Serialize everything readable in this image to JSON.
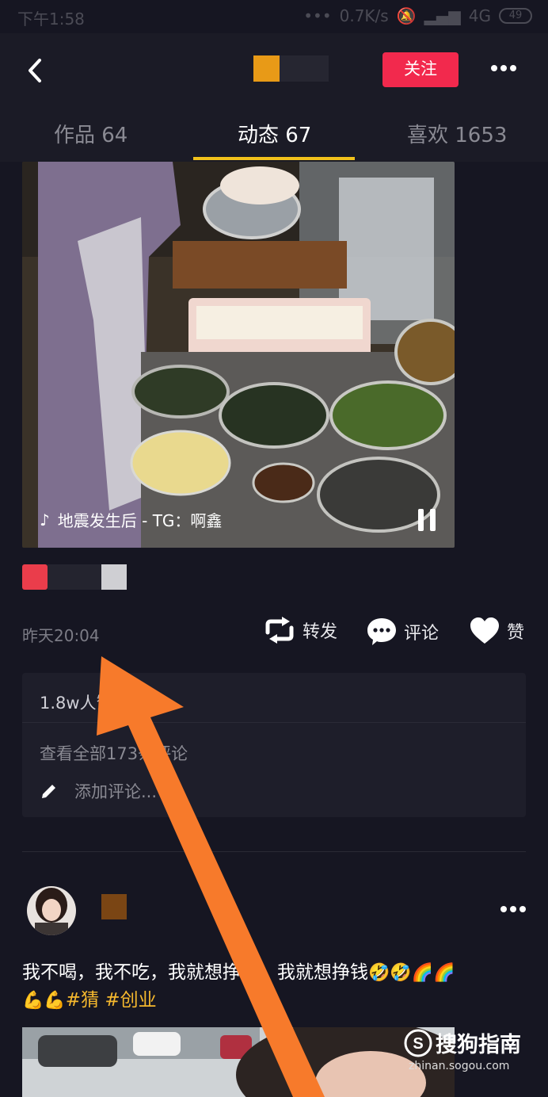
{
  "status_bar": {
    "time": "下午1:58",
    "net_speed": "0.7K/s",
    "network": "4G",
    "battery": "49"
  },
  "header": {
    "follow_label": "关注"
  },
  "tabs": [
    {
      "label": "作品 64",
      "active": false
    },
    {
      "label": "动态 67",
      "active": true
    },
    {
      "label": "喜欢 1653",
      "active": false
    }
  ],
  "post1": {
    "video_caption": "地震发生后 - TG：啊鑫",
    "time": "昨天20:04",
    "actions": {
      "repost": "转发",
      "comment": "评论",
      "like": "赞"
    },
    "comments": {
      "likes_text": "1.8w人赞",
      "view_all": "查看全部173条评论",
      "add_comment": "添加评论..."
    }
  },
  "post2": {
    "text": "我不喝，我不吃，我就想挣钱，我就想挣钱",
    "emojis": "🤣🤣🌈🌈",
    "emojis_2": "💪💪",
    "hashtags": [
      "#猜",
      "#创业"
    ]
  },
  "watermark": {
    "brand": "搜狗指南",
    "url": "zhinan.sogou.com"
  },
  "colors": {
    "background": "#161622",
    "follow_button": "#f2294d",
    "tab_underline": "#f2c21b",
    "hashtag": "#f5b82e",
    "annotation_arrow": "#f77a2b"
  }
}
